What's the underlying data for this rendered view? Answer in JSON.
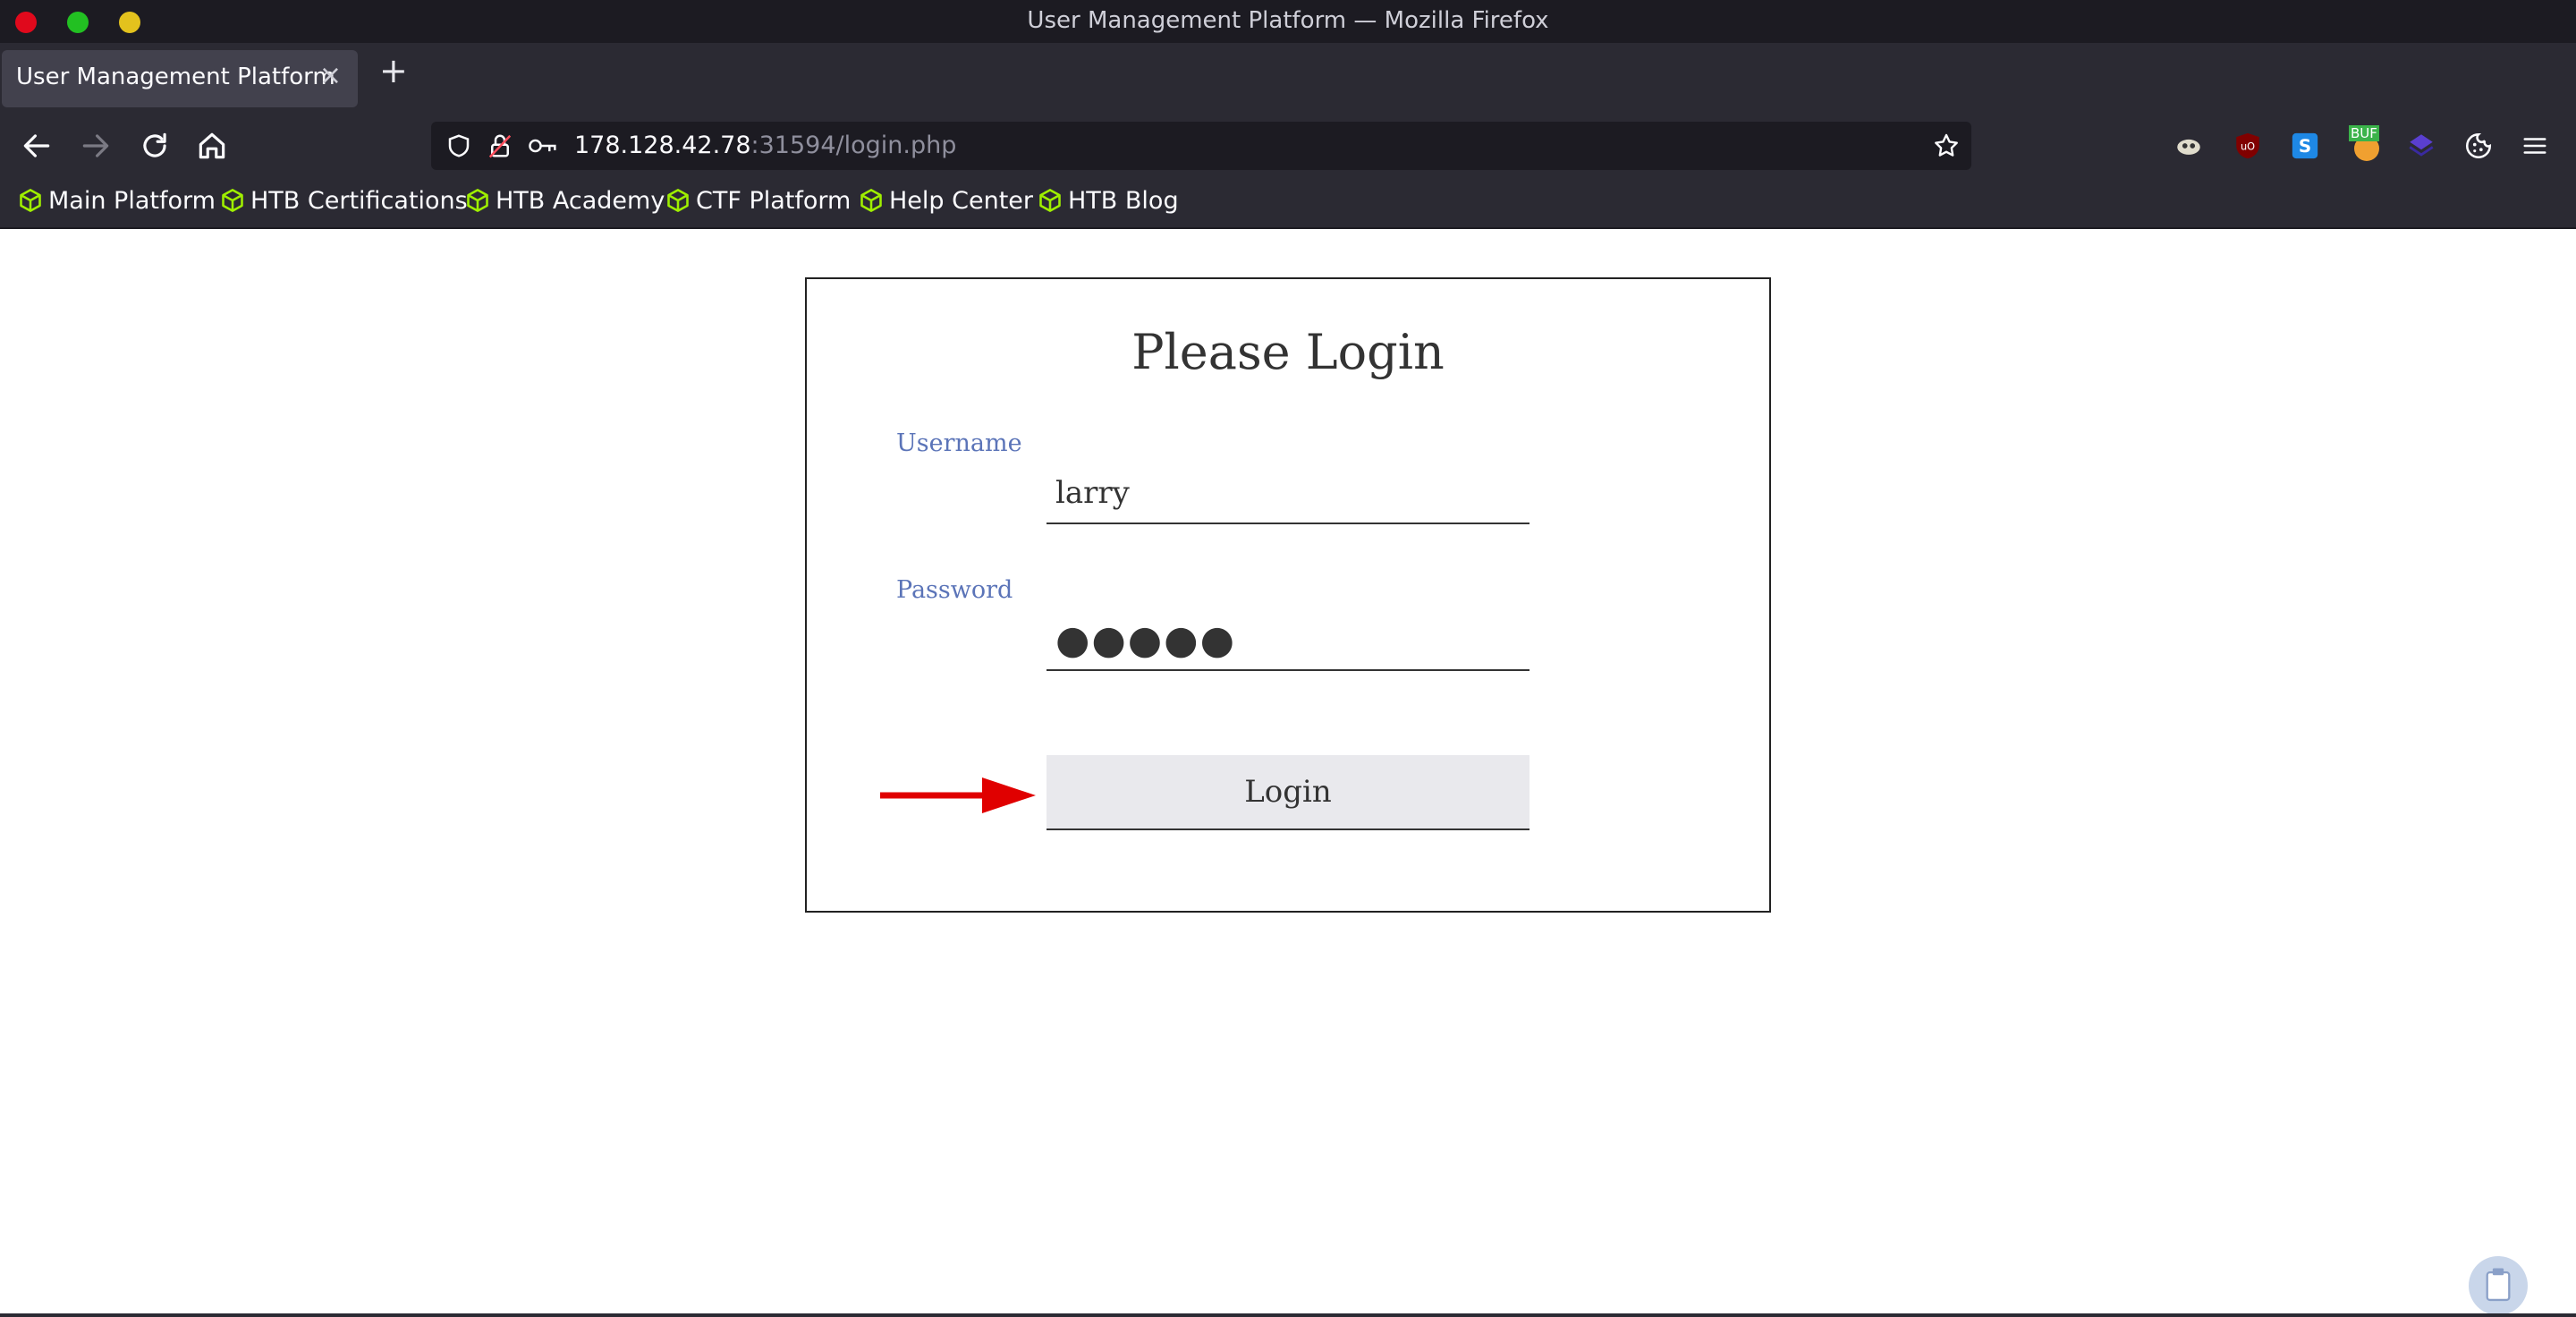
{
  "window": {
    "title": "User Management Platform — Mozilla Firefox"
  },
  "tabs": [
    {
      "label": "User Management Platform",
      "close": "×"
    }
  ],
  "new_tab_label": "+",
  "address_bar": {
    "host": "178.128.42.78",
    "path": ":31594/login.php"
  },
  "nav_icons": [
    "back-icon",
    "forward-icon",
    "reload-icon",
    "home-icon"
  ],
  "extension_icons": [
    "reader-extension-icon",
    "ublock-icon",
    "extension-s-icon",
    "hackbar-extension-icon",
    "layers-extension-icon",
    "cookie-icon",
    "menu-icon"
  ],
  "extension_badge": "BUF",
  "bookmarks": [
    "Main Platform",
    "HTB Certifications",
    "HTB Academy",
    "CTF Platform",
    "Help Center",
    "HTB Blog"
  ],
  "colors": {
    "accent_label": "#5b74b8",
    "bookmark_icon": "#9fef00",
    "arrow": "#e00000"
  },
  "login": {
    "title": "Please Login",
    "username_label": "Username",
    "username_value": "larry",
    "password_label": "Password",
    "password_value": "●●●●●",
    "button_label": "Login"
  }
}
